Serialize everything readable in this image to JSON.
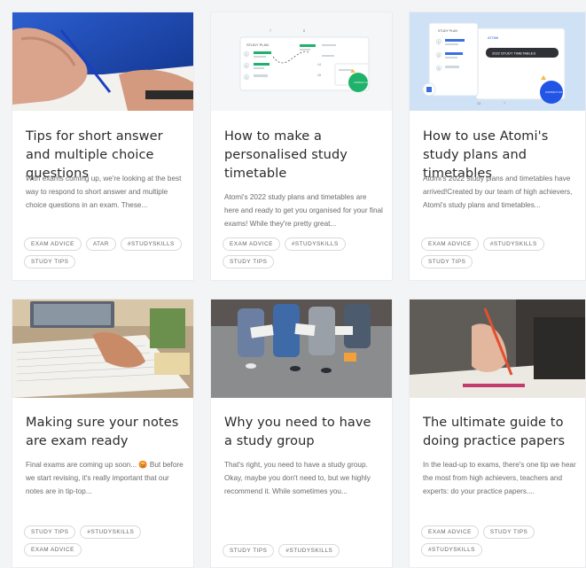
{
  "cards": [
    {
      "title": "Tips for short answer and multiple choice questions",
      "excerpt": "With exams coming up, we're looking at the best way to respond to short answer and multiple choice questions in an exam. These...",
      "tags": [
        "EXAM ADVICE",
        "ATAR",
        "#STUDYSKILLS",
        "STUDY TIPS"
      ]
    },
    {
      "title": "How to make a personalised study timetable",
      "excerpt": "Atomi's 2022 study plans and timetables are here and ready to get you organised for your final exams! While they're pretty great...",
      "tags": [
        "EXAM ADVICE",
        "#STUDYSKILLS",
        "STUDY TIPS"
      ],
      "image_text": {
        "study_plan": "STUDY PLAN",
        "chat": "CONTACT US",
        "c1": "1",
        "c2": "2",
        "c3": "3",
        "t1": "7",
        "t2": "8",
        "t3": "14",
        "t4": "15"
      }
    },
    {
      "title": "How to use Atomi's study plans and timetables",
      "excerpt": "Atomi's 2022 study plans and timetables have arrived!Created by our team of high achievers, Atomi's study plans and timetables...",
      "tags": [
        "EXAM ADVICE",
        "#STUDYSKILLS",
        "STUDY TIPS"
      ],
      "image_text": {
        "study_plan": "STUDY PLAN",
        "brand": "ATOMI",
        "banner": "2022 STUDY TIMETABLES",
        "chat": "CONTACT US",
        "c1": "1",
        "c2": "2",
        "c3": "3",
        "d1": "13",
        "d2": "7"
      }
    },
    {
      "title": "Making sure your notes are exam ready",
      "excerpt": "Final exams are coming up soon... 😡 But before we start revising, it's really important that our notes are in tip-top...",
      "tags": [
        "STUDY TIPS",
        "#STUDYSKILLS",
        "EXAM ADVICE"
      ]
    },
    {
      "title": "Why you need to have a study group",
      "excerpt": "That's right, you need to have a study group. Okay, maybe you don't need to, but we highly recommend it. While sometimes you...",
      "tags": [
        "STUDY TIPS",
        "#STUDYSKILLS"
      ]
    },
    {
      "title": "The ultimate guide to doing practice papers",
      "excerpt": "In the lead-up to exams, there's one tip we hear the most from high achievers, teachers and experts: do your practice papers....",
      "tags": [
        "EXAM ADVICE",
        "STUDY TIPS",
        "#STUDYSKILLS"
      ]
    }
  ]
}
